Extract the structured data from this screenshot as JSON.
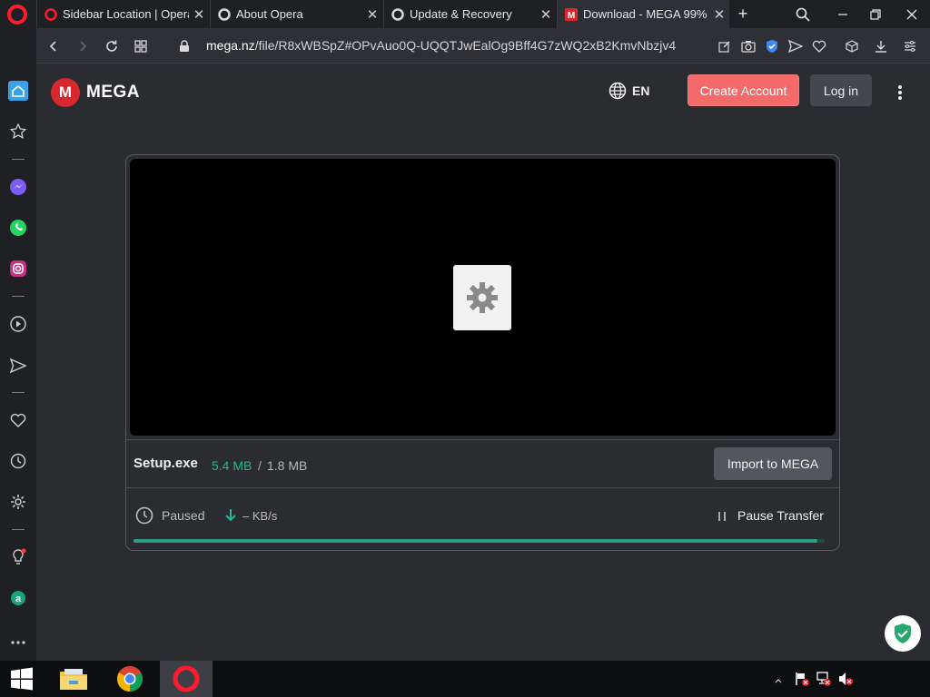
{
  "browser": {
    "tabs": [
      {
        "label": "Sidebar Location | Opera f",
        "icon": "opera-icon",
        "active": false
      },
      {
        "label": "About Opera",
        "icon": "opera-icon",
        "active": false
      },
      {
        "label": "Update & Recovery",
        "icon": "opera-icon",
        "active": false
      },
      {
        "label": "Download - MEGA 99%",
        "icon": "mega-icon",
        "active": true
      }
    ],
    "new_tab": "+",
    "url_host": "mega.nz",
    "url_path": "/file/R8xWBSpZ#OPvAuo0Q-UQQTJwEalOg9Bff4G7zWQ2xB2KmvNbzjv4"
  },
  "header": {
    "logo_letter": "M",
    "brand": "MEGA",
    "language": "EN",
    "create_account": "Create Account",
    "login": "Log in"
  },
  "file": {
    "name": "Setup.exe",
    "downloaded": "5.4 MB",
    "separator": "/",
    "total": "1.8 MB",
    "import_button": "Import to MEGA",
    "status": "Paused",
    "speed": "– KB/s",
    "pause_button": "Pause Transfer",
    "progress_percent": 99
  },
  "colors": {
    "accent": "#f46a6a",
    "progress": "#2a9d7d",
    "downloaded_text": "#27b68e",
    "mega_red": "#d9272e"
  }
}
